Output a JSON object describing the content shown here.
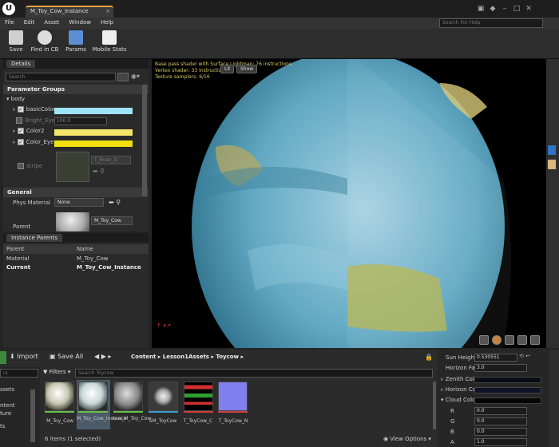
{
  "window": {
    "logo": "U",
    "tab_title": "M_Toy_Cow_Instance",
    "tab_close": "×"
  },
  "menu": [
    "File",
    "Edit",
    "Asset",
    "Window",
    "Help"
  ],
  "help_search_placeholder": "Search For Help",
  "toolbar": {
    "save": "Save",
    "find_in_cb": "Find in CB",
    "params": "Params",
    "mobile_stats": "Mobile Stats"
  },
  "details": {
    "tab": "Details",
    "search_placeholder": "Search",
    "param_groups": "Parameter Groups",
    "body": "body",
    "params": [
      {
        "name": "basicColor",
        "color": "#9ee4f7"
      },
      {
        "name": "Bright_Eye",
        "value": "100.0"
      },
      {
        "name": "Color2",
        "color": "#f5e56b"
      },
      {
        "name": "Color_Eye",
        "color": "#f0e010"
      }
    ],
    "stripe": "stripe",
    "stripe_texture": "T_Bosn_D",
    "general": "General",
    "phys_material_label": "Phys Material",
    "phys_material_value": "None",
    "parent_label": "Parent",
    "parent_value": "M_Toy_Cow"
  },
  "instance_parents": {
    "tab": "Instance Parents",
    "col_parent": "Parent",
    "col_name": "Name",
    "rows": [
      {
        "label": "Material",
        "value": "M_Toy_Cow"
      },
      {
        "label": "Current",
        "value": "M_Toy_Cow_Instance"
      }
    ]
  },
  "viewport": {
    "stats": [
      "Base pass shader with Surface Lightmap: 76 instructions",
      "Vertex shader: 33 instructions",
      "Texture samplers: 6/16"
    ],
    "lit": "Lit",
    "show": "Show"
  },
  "content_browser": {
    "import": "Import",
    "save_all": "Save All",
    "breadcrumb": [
      "Content",
      "Lesson1Assets",
      "Toycow"
    ],
    "filters": "Filters",
    "search_placeholder": "Search Toycow",
    "left_items": [
      "ssets",
      "ntent",
      "ture",
      "ts"
    ],
    "left_filter": "rs",
    "assets": [
      {
        "name": "M_Toy_Cow"
      },
      {
        "name": "M_Toy_Cow_Instance"
      },
      {
        "name": "new_M_Toy_Cow"
      },
      {
        "name": "SM_ToyCow"
      },
      {
        "name": "T_ToyCow_C"
      },
      {
        "name": "T_ToyCow_N"
      }
    ],
    "status": "6 items (1 selected)",
    "view_options": "View Options"
  },
  "right_panel": {
    "sun_height_label": "Sun Height",
    "sun_height_value": "0.530551",
    "horizon_far_label": "Horizon Far",
    "horizon_far_value": "3.0",
    "zenith_color": "Zenith Colo",
    "horizon_color": "Horizon Co",
    "cloud_color": "Cloud Color",
    "channels": [
      {
        "label": "R",
        "value": "0.0"
      },
      {
        "label": "G",
        "value": "0.0"
      },
      {
        "label": "B",
        "value": "0.0"
      },
      {
        "label": "A",
        "value": "1.0"
      }
    ]
  }
}
